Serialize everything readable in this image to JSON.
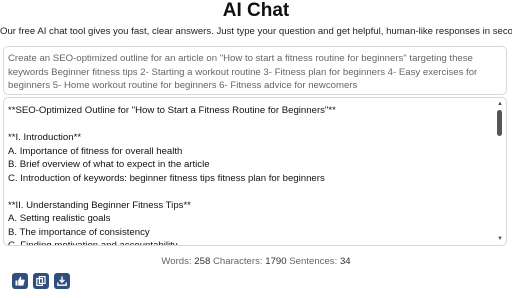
{
  "header": {
    "title": "AI Chat",
    "subtitle": "Our free AI chat tool gives you fast, clear answers. Just type your question and get helpful, human-like responses in seconds."
  },
  "prompt": {
    "value": "Create an SEO-optimized outline for an article on \"How to start a fitness routine for beginners\" targeting these keywords Beginner fitness tips 2- Starting a workout routine 3- Fitness plan for beginners 4- Easy exercises for beginners 5- Home workout routine for beginners 6- Fitness advice for newcomers"
  },
  "output": {
    "lines": [
      "**SEO-Optimized Outline for \"How to Start a Fitness Routine for Beginners\"**",
      "",
      "**I. Introduction**",
      "A. Importance of fitness for overall health",
      "B. Brief overview of what to expect in the article",
      "C. Introduction of keywords: beginner fitness tips fitness plan for beginners",
      "",
      "**II. Understanding Beginner Fitness Tips**",
      "A. Setting realistic goals",
      "B. The importance of consistency",
      "C. Finding motivation and accountability"
    ]
  },
  "stats": {
    "words_label": "Words:",
    "words": "258",
    "characters_label": "Characters:",
    "characters": "1790",
    "sentences_label": "Sentences:",
    "sentences": "34"
  },
  "actions": {
    "icons": [
      "thumbs-up-icon",
      "copy-icon",
      "download-icon"
    ]
  },
  "colors": {
    "button_bg": "#2f4f7f",
    "border": "#d8d8d8",
    "muted_text": "#666666"
  }
}
